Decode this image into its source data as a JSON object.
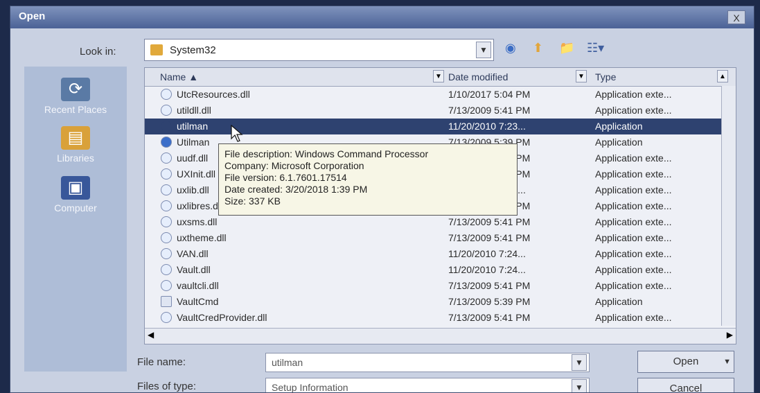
{
  "window": {
    "title": "Open",
    "close_label": "X"
  },
  "lookin": {
    "label": "Look in:",
    "value": "System32"
  },
  "places": [
    {
      "name": "recent-places",
      "label": "Recent Places"
    },
    {
      "name": "libraries",
      "label": "Libraries"
    },
    {
      "name": "computer",
      "label": "Computer"
    }
  ],
  "columns": {
    "name": "Name",
    "date": "Date modified",
    "type": "Type"
  },
  "files": [
    {
      "name": "UtcResources.dll",
      "date": "1/10/2017 5:04 PM",
      "type": "Application exte..."
    },
    {
      "name": "utildll.dll",
      "date": "7/13/2009 5:41 PM",
      "type": "Application exte..."
    },
    {
      "name": "utilman",
      "date": "11/20/2010 7:23...",
      "type": "Application"
    },
    {
      "name": "Utilman",
      "date": "7/13/2009 5:39 PM",
      "type": "Application"
    },
    {
      "name": "uudf.dll",
      "date": "7/13/2009 5:41 PM",
      "type": "Application exte..."
    },
    {
      "name": "UXInit.dll",
      "date": "7/13/2009 5:41 PM",
      "type": "Application exte..."
    },
    {
      "name": "uxlib.dll",
      "date": "11/20/2010 7:24...",
      "type": "Application exte..."
    },
    {
      "name": "uxlibres.dll",
      "date": "7/13/2009 5:33 PM",
      "type": "Application exte..."
    },
    {
      "name": "uxsms.dll",
      "date": "7/13/2009 5:41 PM",
      "type": "Application exte..."
    },
    {
      "name": "uxtheme.dll",
      "date": "7/13/2009 5:41 PM",
      "type": "Application exte..."
    },
    {
      "name": "VAN.dll",
      "date": "11/20/2010 7:24...",
      "type": "Application exte..."
    },
    {
      "name": "Vault.dll",
      "date": "11/20/2010 7:24...",
      "type": "Application exte..."
    },
    {
      "name": "vaultcli.dll",
      "date": "7/13/2009 5:41 PM",
      "type": "Application exte..."
    },
    {
      "name": "VaultCmd",
      "date": "7/13/2009 5:39 PM",
      "type": "Application"
    },
    {
      "name": "VaultCredProvider.dll",
      "date": "7/13/2009 5:41 PM",
      "type": "Application exte..."
    }
  ],
  "tooltip": {
    "description": "File description: Windows Command Processor",
    "company": "Company: Microsoft Corporation",
    "version": "File version: 6.1.7601.17514",
    "created": "Date created: 3/20/2018 1:39 PM",
    "size": "Size: 337 KB"
  },
  "filename": {
    "label": "File name:",
    "value": "utilman"
  },
  "filetype": {
    "label": "Files of type:",
    "value": "Setup Information"
  },
  "buttons": {
    "open": "Open",
    "cancel": "Cancel"
  }
}
